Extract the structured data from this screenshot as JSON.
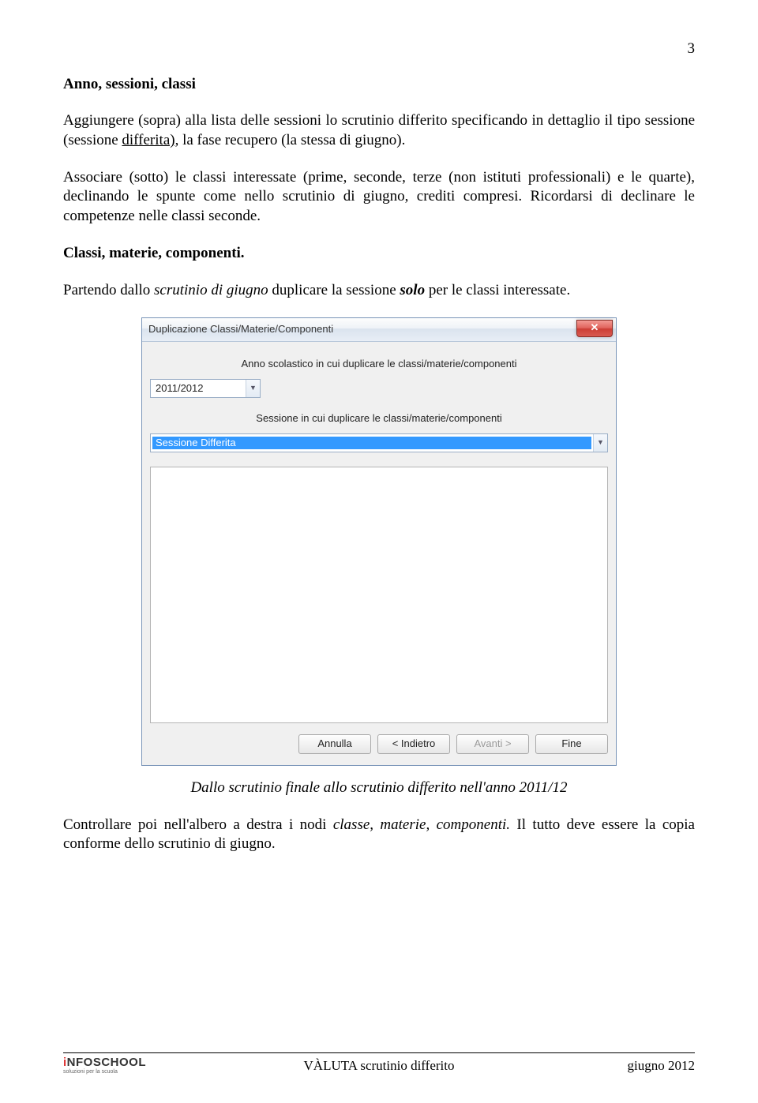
{
  "page_number": "3",
  "heading1": "Anno, sessioni, classi",
  "para1_a": "Aggiungere (sopra) alla lista delle sessioni lo scrutinio differito specificando in dettaglio il tipo sessione (sessione ",
  "para1_underlined": "differita)",
  "para1_b": ", la fase recupero (la stessa di giugno).",
  "para2": "Associare (sotto) le classi interessate (prime, seconde, terze (non istituti professionali) e le quarte), declinando le spunte come nello scrutinio di giugno, crediti compresi. Ricordarsi di declinare le competenze nelle classi seconde.",
  "heading2": "Classi, materie, componenti.",
  "para3_a": "Partendo dallo ",
  "para3_it1": "scrutinio di giugno",
  "para3_b": " duplicare la sessione ",
  "para3_it2": "solo",
  "para3_c": " per le classi interessate.",
  "dialog": {
    "title": "Duplicazione Classi/Materie/Componenti",
    "label1": "Anno scolastico in cui duplicare le classi/materie/componenti",
    "combo1_value": "2011/2012",
    "label2": "Sessione in cui duplicare le classi/materie/componenti",
    "combo2_value": "Sessione Differita",
    "btn_cancel": "Annulla",
    "btn_back": "< Indietro",
    "btn_next": "Avanti >",
    "btn_finish": "Fine"
  },
  "caption": "Dallo scrutinio finale allo scrutinio differito nell'anno 2011/12",
  "para4_a": "Controllare poi nell'albero a destra i nodi ",
  "para4_it": "classe, materie, componenti.",
  "para4_b": " Il tutto deve essere la copia conforme dello scrutinio di giugno.",
  "footer": {
    "logo_prefix": "i",
    "logo_rest": "NFOSCHOOL",
    "logo_sub": "soluzioni per la scuola",
    "center": "VÀLUTA scrutinio differito",
    "right": "giugno 2012"
  }
}
